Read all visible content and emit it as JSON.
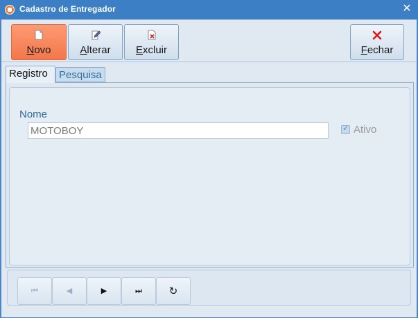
{
  "window": {
    "title": "Cadastro de Entregador",
    "close_icon": "close-icon"
  },
  "toolbar": {
    "buttons": [
      {
        "label_ul": "N",
        "label_rest": "ovo",
        "icon": "new-document-icon",
        "active": true
      },
      {
        "label_ul": "A",
        "label_rest": "lterar",
        "icon": "edit-document-icon",
        "active": false
      },
      {
        "label_ul": "E",
        "label_rest": "xcluir",
        "icon": "delete-document-icon",
        "active": false
      },
      {
        "label_ul": "F",
        "label_rest": "echar",
        "icon": "close-red-x-icon",
        "active": false
      }
    ]
  },
  "tabs": [
    {
      "label": "Registro",
      "selected": true
    },
    {
      "label": "Pesquisa",
      "selected": false
    }
  ],
  "form": {
    "nome_label": "Nome",
    "nome_value": "MOTOBOY",
    "ativo_label": "Ativo",
    "ativo_checked": true
  },
  "navigator": {
    "buttons": [
      {
        "icon": "first-record-icon",
        "glyph": "⏮",
        "enabled": false
      },
      {
        "icon": "prior-record-icon",
        "glyph": "◀",
        "enabled": false
      },
      {
        "icon": "next-record-icon",
        "glyph": "▶",
        "enabled": true
      },
      {
        "icon": "last-record-icon",
        "glyph": "⏭",
        "enabled": true
      },
      {
        "icon": "refresh-icon",
        "glyph": "↻",
        "enabled": true
      }
    ]
  },
  "colors": {
    "titlebar": "#3d7fc4",
    "active_button": "#f2774c",
    "label_blue": "#2d6a97"
  }
}
